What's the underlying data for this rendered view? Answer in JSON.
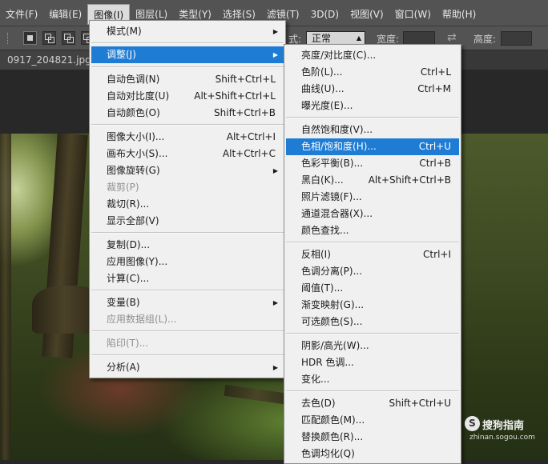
{
  "menubar": {
    "items": [
      "文件(F)",
      "编辑(E)",
      "图像(I)",
      "图层(L)",
      "类型(Y)",
      "选择(S)",
      "滤镜(T)",
      "3D(D)",
      "视图(V)",
      "窗口(W)",
      "帮助(H)"
    ],
    "active_index": 2
  },
  "options_bar": {
    "style_value": "正常",
    "width_label": "宽度:",
    "height_label": "高度:",
    "left_fragment": "式:"
  },
  "document": {
    "tab_title": "0917_204821.jpg @"
  },
  "image_menu": {
    "items": [
      {
        "label": "模式(M)",
        "shortcut": "",
        "submenu": true,
        "disabled": false
      },
      {
        "label": "调整(J)",
        "shortcut": "",
        "submenu": true,
        "disabled": false,
        "highlighted": true
      },
      {
        "label": "自动色调(N)",
        "shortcut": "Shift+Ctrl+L",
        "disabled": false
      },
      {
        "label": "自动对比度(U)",
        "shortcut": "Alt+Shift+Ctrl+L",
        "disabled": false
      },
      {
        "label": "自动颜色(O)",
        "shortcut": "Shift+Ctrl+B",
        "disabled": false
      },
      {
        "label": "图像大小(I)...",
        "shortcut": "Alt+Ctrl+I",
        "disabled": false
      },
      {
        "label": "画布大小(S)...",
        "shortcut": "Alt+Ctrl+C",
        "disabled": false
      },
      {
        "label": "图像旋转(G)",
        "shortcut": "",
        "submenu": true,
        "disabled": false
      },
      {
        "label": "裁剪(P)",
        "shortcut": "",
        "disabled": true
      },
      {
        "label": "裁切(R)...",
        "shortcut": "",
        "disabled": false
      },
      {
        "label": "显示全部(V)",
        "shortcut": "",
        "disabled": false
      },
      {
        "label": "复制(D)...",
        "shortcut": "",
        "disabled": false
      },
      {
        "label": "应用图像(Y)...",
        "shortcut": "",
        "disabled": false
      },
      {
        "label": "计算(C)...",
        "shortcut": "",
        "disabled": false
      },
      {
        "label": "变量(B)",
        "shortcut": "",
        "submenu": true,
        "disabled": false
      },
      {
        "label": "应用数据组(L)...",
        "shortcut": "",
        "disabled": true
      },
      {
        "label": "陷印(T)...",
        "shortcut": "",
        "disabled": true
      },
      {
        "label": "分析(A)",
        "shortcut": "",
        "submenu": true,
        "disabled": false
      }
    ]
  },
  "adjust_menu": {
    "items": [
      {
        "label": "亮度/对比度(C)...",
        "shortcut": ""
      },
      {
        "label": "色阶(L)...",
        "shortcut": "Ctrl+L"
      },
      {
        "label": "曲线(U)...",
        "shortcut": "Ctrl+M"
      },
      {
        "label": "曝光度(E)...",
        "shortcut": ""
      },
      {
        "label": "自然饱和度(V)...",
        "shortcut": ""
      },
      {
        "label": "色相/饱和度(H)...",
        "shortcut": "Ctrl+U",
        "highlighted": true
      },
      {
        "label": "色彩平衡(B)...",
        "shortcut": "Ctrl+B"
      },
      {
        "label": "黑白(K)...",
        "shortcut": "Alt+Shift+Ctrl+B"
      },
      {
        "label": "照片滤镜(F)...",
        "shortcut": ""
      },
      {
        "label": "通道混合器(X)...",
        "shortcut": ""
      },
      {
        "label": "颜色查找...",
        "shortcut": ""
      },
      {
        "label": "反相(I)",
        "shortcut": "Ctrl+I"
      },
      {
        "label": "色调分离(P)...",
        "shortcut": ""
      },
      {
        "label": "阈值(T)...",
        "shortcut": ""
      },
      {
        "label": "渐变映射(G)...",
        "shortcut": ""
      },
      {
        "label": "可选颜色(S)...",
        "shortcut": ""
      },
      {
        "label": "阴影/高光(W)...",
        "shortcut": ""
      },
      {
        "label": "HDR 色调...",
        "shortcut": ""
      },
      {
        "label": "变化...",
        "shortcut": ""
      },
      {
        "label": "去色(D)",
        "shortcut": "Shift+Ctrl+U"
      },
      {
        "label": "匹配颜色(M)...",
        "shortcut": ""
      },
      {
        "label": "替换颜色(R)...",
        "shortcut": ""
      },
      {
        "label": "色调均化(Q)",
        "shortcut": ""
      }
    ]
  },
  "watermark": {
    "logo": "S",
    "name": "搜狗指南",
    "url": "zhinan.sogou.com"
  },
  "colors": {
    "highlight": "#1e7cd4",
    "menubar": "#535353",
    "menu_bg": "#f0f0f0"
  }
}
